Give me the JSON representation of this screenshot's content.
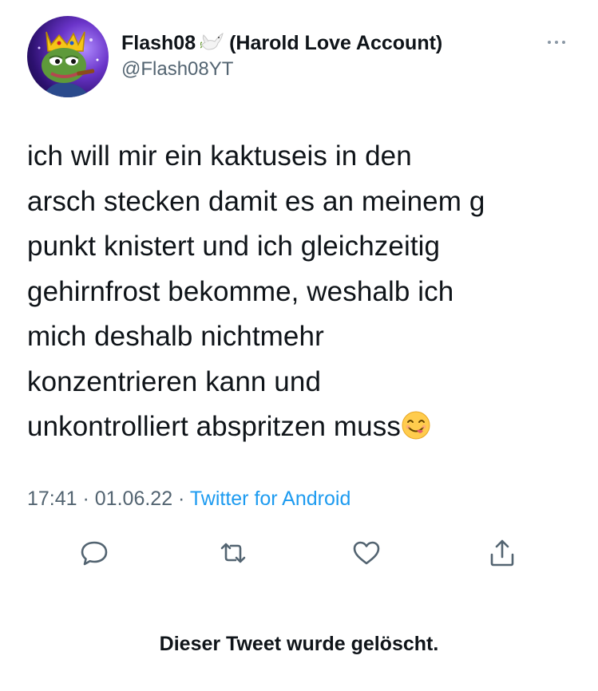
{
  "tweet": {
    "display_name": "Flash08",
    "display_name_suffix": "(Harold Love Account)",
    "handle": "@Flash08YT",
    "avatar_icon": "pepe-crown-avatar",
    "name_icon": "dove-emoji-icon",
    "text_lines": [
      "ich will mir ein kaktuseis in den",
      "arsch stecken damit es an meinem g",
      "punkt knistert und ich gleichzeitig",
      "gehirnfrost bekomme, weshalb ich",
      "mich deshalb nichtmehr",
      "konzentrieren kann und",
      "unkontrolliert abspritzen muss"
    ],
    "end_emoji": "yum-face-emoji",
    "time": "17:41",
    "separator": " · ",
    "date": "01.06.22",
    "source": "Twitter for Android"
  },
  "actions": {
    "reply": "reply-icon",
    "retweet": "retweet-icon",
    "like": "heart-icon",
    "share": "share-icon"
  },
  "footer": {
    "deleted_text": "Dieser Tweet wurde gelöscht."
  },
  "colors": {
    "text": "#0f1419",
    "secondary": "#536471",
    "link": "#1d9bf0",
    "icon": "#536471"
  }
}
